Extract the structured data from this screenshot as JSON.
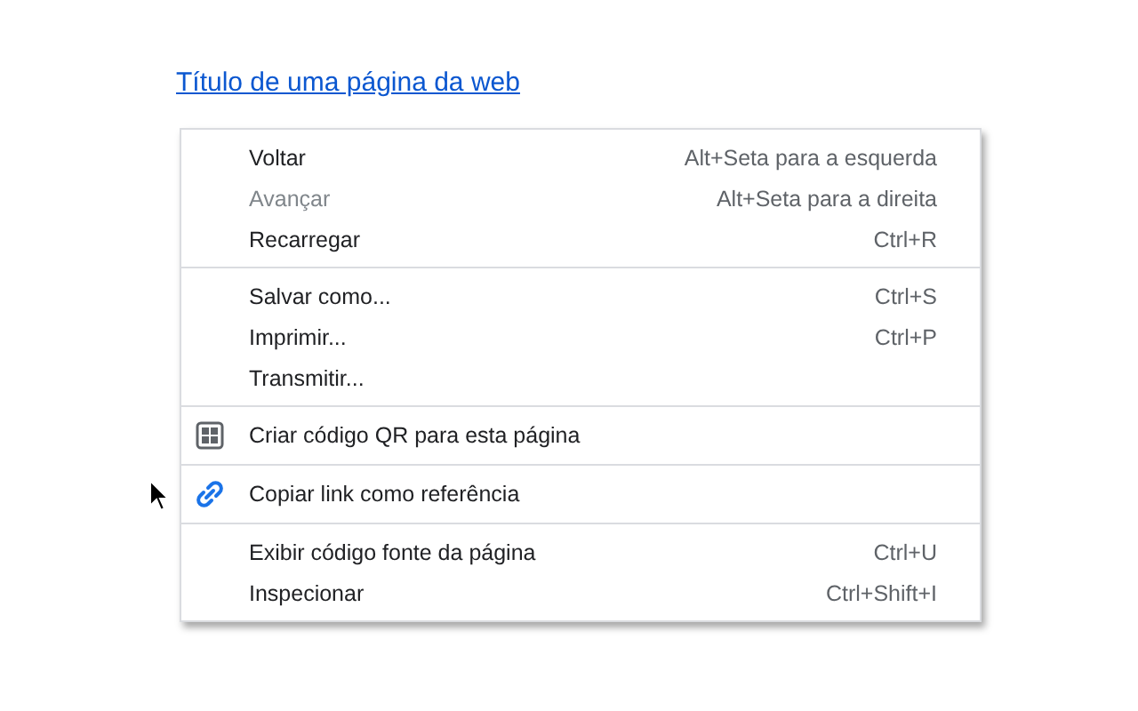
{
  "page": {
    "link": "Título de uma página da web"
  },
  "context_menu": {
    "groups": [
      {
        "items": [
          {
            "label": "Voltar",
            "shortcut": "Alt+Seta para a esquerda",
            "disabled": false
          },
          {
            "label": "Avançar",
            "shortcut": "Alt+Seta para a direita",
            "disabled": true
          },
          {
            "label": "Recarregar",
            "shortcut": "Ctrl+R",
            "disabled": false
          }
        ]
      },
      {
        "items": [
          {
            "label": "Salvar como...",
            "shortcut": "Ctrl+S",
            "disabled": false
          },
          {
            "label": "Imprimir...",
            "shortcut": "Ctrl+P",
            "disabled": false
          },
          {
            "label": "Transmitir...",
            "disabled": false
          }
        ]
      },
      {
        "items": [
          {
            "label": "Criar código QR para esta página",
            "kind": "qr",
            "disabled": false
          }
        ]
      },
      {
        "items": [
          {
            "label": "Copiar link como referência",
            "kind": "link",
            "disabled": false
          }
        ]
      },
      {
        "items": [
          {
            "label": "Exibir código fonte da página",
            "shortcut": "Ctrl+U",
            "disabled": false
          },
          {
            "label": "Inspecionar",
            "shortcut": "Ctrl+Shift+I",
            "disabled": false
          }
        ]
      }
    ]
  }
}
